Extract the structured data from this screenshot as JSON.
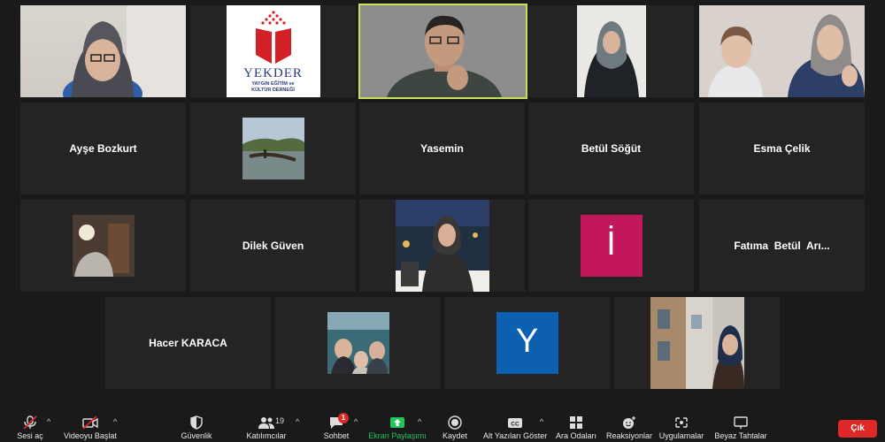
{
  "participants": {
    "ayse": "Ayşe Bozkurt",
    "yasemin": "Yasemin",
    "betul": "Betül Söğüt",
    "esma": "Esma Çelik",
    "dilek": "Dilek Güven",
    "fatima": "Fatıma  Betül  Arı...",
    "hacer": "Hacer KARACA"
  },
  "avatars": {
    "letter_i": "İ",
    "letter_y": "Y",
    "letter_i_color": "#c2185b",
    "letter_y_color": "#0d5fb0"
  },
  "logo": {
    "name": "YEKDER",
    "subtitle_1": "YAYGIN EĞİTİM ve",
    "subtitle_2": "KÜLTÜR DERNEĞİ"
  },
  "toolbar": {
    "mute": "Sesi aç",
    "video": "Videoyu Başlat",
    "security": "Güvenlik",
    "participants": "Katılımcılar",
    "participants_count": "19",
    "chat": "Sohbet",
    "chat_badge": "1",
    "share": "Ekran Paylaşımı",
    "record": "Kaydet",
    "captions": "Alt Yazıları Göster",
    "breakout": "Ara Odaları",
    "reactions": "Reaksiyonlar",
    "apps": "Uygulamalar",
    "whiteboard": "Beyaz Tahtalar",
    "leave": "Çık"
  },
  "colors": {
    "active_speaker_border": "#c8e05a",
    "share_green": "#22c55e",
    "leave_red": "#e02828"
  }
}
